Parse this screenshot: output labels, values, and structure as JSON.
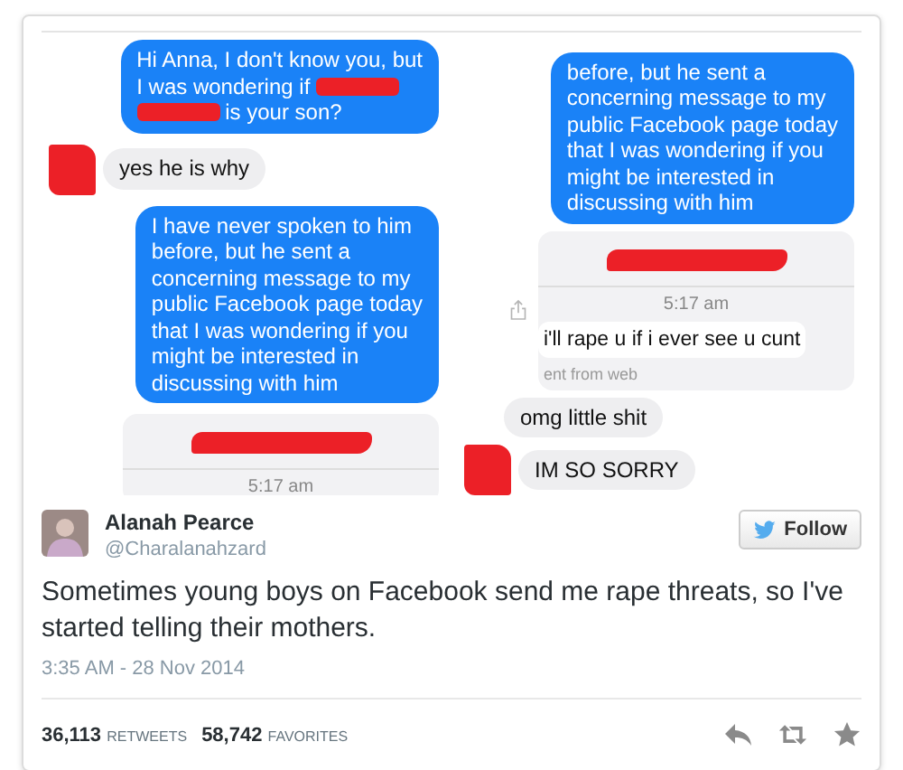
{
  "screenshots": [
    {
      "kind": "top-aligned",
      "messages": [
        {
          "kind": "sent",
          "lines": [
            [
              {
                "kind": "text",
                "text": "Hi Anna, I don't know you, but"
              }
            ],
            [
              {
                "kind": "text",
                "text": "I was wondering if"
              },
              {
                "kind": "redaction"
              }
            ],
            [
              {
                "kind": "redaction"
              },
              {
                "kind": "text",
                "text": "is your son?"
              }
            ]
          ]
        },
        {
          "kind": "received",
          "avatar_redacted": true,
          "lines": [
            [
              {
                "kind": "text",
                "text": "yes he is why"
              }
            ]
          ]
        },
        {
          "kind": "sent",
          "lines": [
            [
              {
                "kind": "text",
                "text": "I have never spoken to him"
              }
            ],
            [
              {
                "kind": "text",
                "text": "before, but he sent a"
              }
            ],
            [
              {
                "kind": "text",
                "text": "concerning message to my"
              }
            ],
            [
              {
                "kind": "text",
                "text": "public Facebook page today"
              }
            ],
            [
              {
                "kind": "text",
                "text": "that I was wondering if you"
              }
            ],
            [
              {
                "kind": "text",
                "text": "might be interested in"
              }
            ],
            [
              {
                "kind": "text",
                "text": "discussing with him"
              }
            ]
          ]
        },
        {
          "kind": "card",
          "time": "5:17 am"
        }
      ]
    },
    {
      "kind": "bottom-aligned",
      "messages": [
        {
          "kind": "sent",
          "lines": [
            [
              {
                "kind": "text",
                "text": "before, but he sent a"
              }
            ],
            [
              {
                "kind": "text",
                "text": "concerning message to my"
              }
            ],
            [
              {
                "kind": "text",
                "text": "public Facebook page today"
              }
            ],
            [
              {
                "kind": "text",
                "text": "that I was wondering if you"
              }
            ],
            [
              {
                "kind": "text",
                "text": "might be interested in"
              }
            ],
            [
              {
                "kind": "text",
                "text": "discussing with him"
              }
            ]
          ]
        },
        {
          "kind": "card",
          "time": "5:17 am",
          "quote": "i'll rape u if i ever see u cunt",
          "source": "ent from web"
        },
        {
          "kind": "received",
          "avatar_redacted": false,
          "lines": [
            [
              {
                "kind": "text",
                "text": "omg little shit"
              }
            ]
          ]
        },
        {
          "kind": "received",
          "avatar_redacted": true,
          "lines": [
            [
              {
                "kind": "text",
                "text": "IM SO SORRY"
              }
            ]
          ]
        }
      ]
    }
  ],
  "tweet": {
    "name": "Alanah Pearce",
    "handle": "@Charalanahzard",
    "follow": "Follow",
    "text": "Sometimes young boys on Facebook send me rape threats, so I've started telling their mothers.",
    "date": "3:35 AM - 28 Nov 2014",
    "stats": [
      {
        "count": "36,113",
        "label": "RETWEETS"
      },
      {
        "count": "58,742",
        "label": "FAVORITES"
      }
    ]
  }
}
